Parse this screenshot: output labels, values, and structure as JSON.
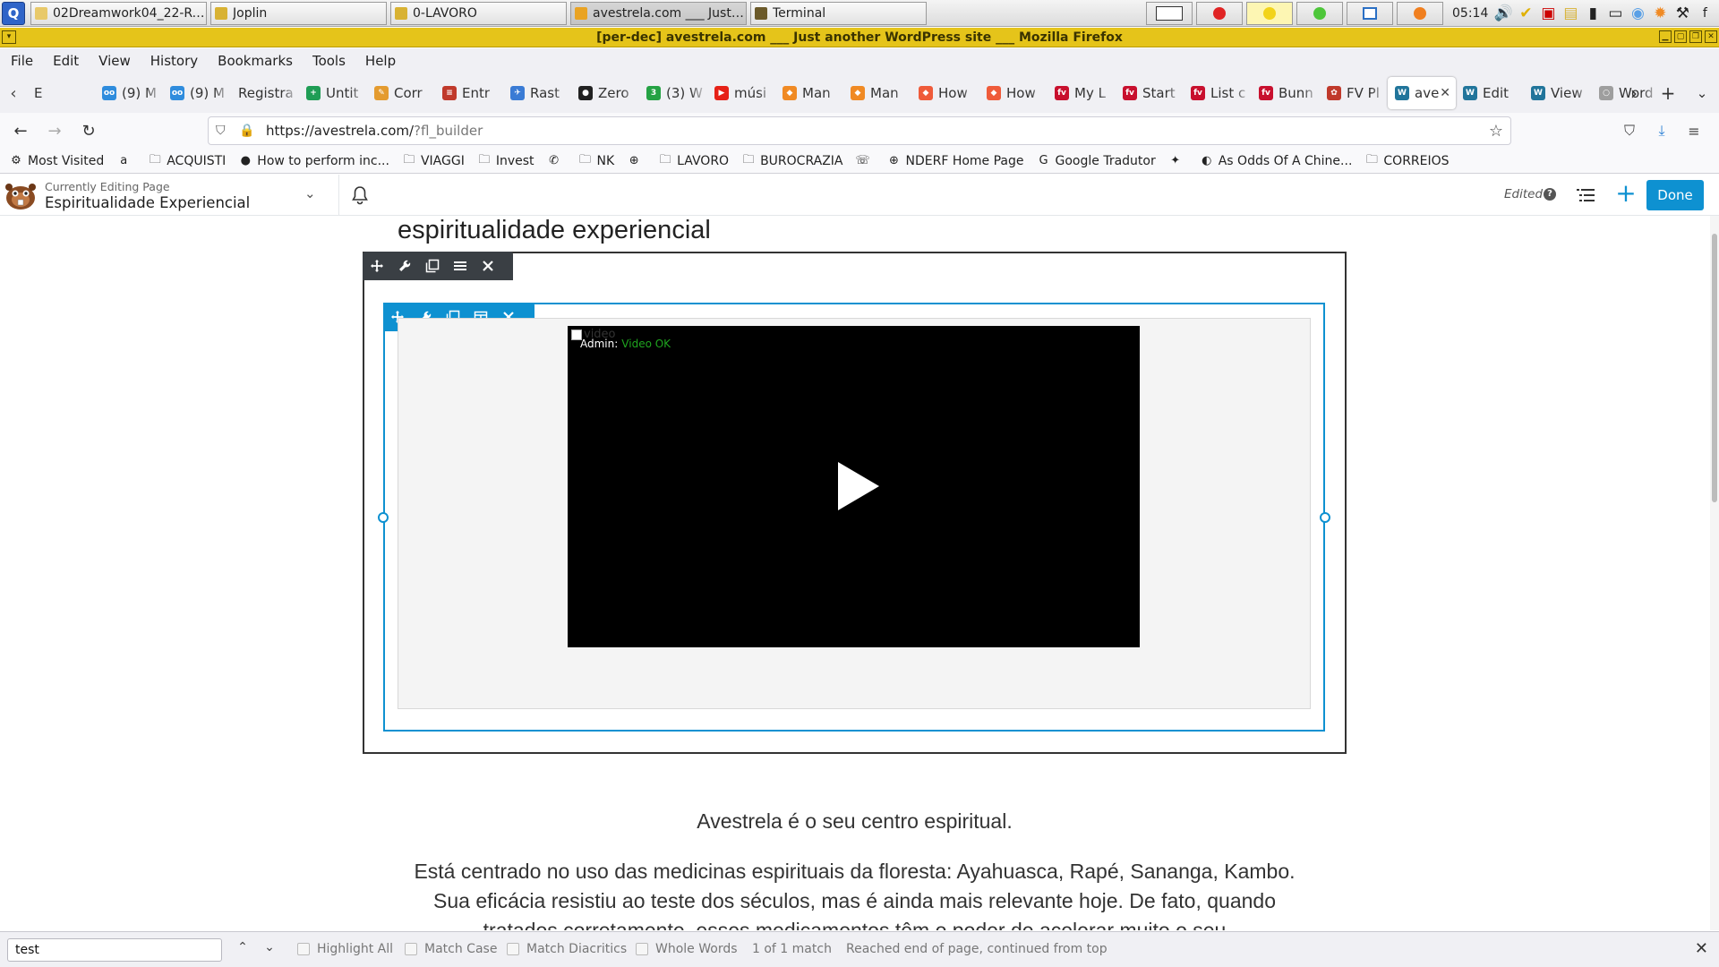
{
  "taskbar": {
    "start_label": "Q",
    "tasks": [
      {
        "label": "02Dreamwork04_22-Rob...",
        "icon": "folder-icon",
        "color": "#e8c96a"
      },
      {
        "label": "Joplin",
        "icon": "lock-icon",
        "color": "#d8b233"
      },
      {
        "label": "0-LAVORO",
        "icon": "file-icon",
        "color": "#d8b233"
      },
      {
        "label": "avestrela.com ___ Just a...",
        "icon": "firefox-icon",
        "color": "#e9a323",
        "active": true
      },
      {
        "label": "Terminal",
        "icon": "terminal-icon",
        "color": "#6b5a2a"
      }
    ],
    "clock": "05:14"
  },
  "window": {
    "title": "[per-dec] avestrela.com ___ Just another WordPress site ___ Mozilla Firefox"
  },
  "menu": [
    "File",
    "Edit",
    "View",
    "History",
    "Bookmarks",
    "Tools",
    "Help"
  ],
  "tabs": [
    {
      "label": "E",
      "color": "#ffffff"
    },
    {
      "label": "(9) M",
      "color": "#2f8cdd",
      "fav": "oo"
    },
    {
      "label": "(9) M",
      "color": "#2f8cdd",
      "fav": "oo"
    },
    {
      "label": "Registra",
      "color": "#ffffff"
    },
    {
      "label": "Untit",
      "color": "#1f9d55",
      "fav": "+"
    },
    {
      "label": "Corr",
      "color": "#e49b2f",
      "fav": "✎"
    },
    {
      "label": "Entr",
      "color": "#c0392b",
      "fav": "≡"
    },
    {
      "label": "Rast",
      "color": "#3a7bd5",
      "fav": "✈"
    },
    {
      "label": "Zero",
      "color": "#222222",
      "fav": "●"
    },
    {
      "label": "(3) W",
      "color": "#25a244",
      "fav": "3"
    },
    {
      "label": "músi",
      "color": "#e62117",
      "fav": "▶"
    },
    {
      "label": "Man",
      "color": "#f08a24",
      "fav": "◆"
    },
    {
      "label": "Man",
      "color": "#f08a24",
      "fav": "◆"
    },
    {
      "label": "How",
      "color": "#ef5b3a",
      "fav": "◆"
    },
    {
      "label": "How",
      "color": "#ef5b3a",
      "fav": "◆"
    },
    {
      "label": "My L",
      "color": "#c8102e",
      "fav": "fv"
    },
    {
      "label": "Start",
      "color": "#c8102e",
      "fav": "fv"
    },
    {
      "label": "List c",
      "color": "#c8102e",
      "fav": "fv"
    },
    {
      "label": "Bunn",
      "color": "#c8102e",
      "fav": "fv"
    },
    {
      "label": "FV Pl",
      "color": "#c0392b",
      "fav": "✿"
    },
    {
      "label": "ave",
      "color": "#21759b",
      "fav": "W",
      "selected": true
    },
    {
      "label": "Edit",
      "color": "#21759b",
      "fav": "W"
    },
    {
      "label": "View",
      "color": "#21759b",
      "fav": "W"
    },
    {
      "label": "Word",
      "color": "#9e9e9e",
      "fav": "○"
    }
  ],
  "nav": {
    "url_host": "https://avestrela.com/",
    "url_path": "?fl_builder"
  },
  "bookmarks": [
    {
      "label": "Most Visited",
      "icon": "gear-icon",
      "glyph": "⚙"
    },
    {
      "label": "",
      "icon": "amazon-icon",
      "glyph": "a"
    },
    {
      "label": "ACQUISTI",
      "icon": "folder-icon",
      "glyph": "🗀"
    },
    {
      "label": "How to perform inc...",
      "icon": "ubuntu-icon",
      "glyph": "●"
    },
    {
      "label": "VIAGGI",
      "icon": "folder-icon",
      "glyph": "🗀"
    },
    {
      "label": "Invest",
      "icon": "folder-icon",
      "glyph": "🗀"
    },
    {
      "label": "",
      "icon": "whatsapp-icon",
      "glyph": "✆"
    },
    {
      "label": "NK",
      "icon": "folder-icon",
      "glyph": "🗀"
    },
    {
      "label": "",
      "icon": "globe-icon",
      "glyph": "⊕"
    },
    {
      "label": "LAVORO",
      "icon": "folder-icon",
      "glyph": "🗀"
    },
    {
      "label": "BUROCRAZIA",
      "icon": "folder-icon",
      "glyph": "🗀"
    },
    {
      "label": "",
      "icon": "phone-icon",
      "glyph": "☏"
    },
    {
      "label": "NDERF Home Page",
      "icon": "globe-icon",
      "glyph": "⊕"
    },
    {
      "label": "Google Tradutor",
      "icon": "translate-icon",
      "glyph": "G"
    },
    {
      "label": "",
      "icon": "twitter-icon",
      "glyph": "✦"
    },
    {
      "label": "As Odds Of A Chine...",
      "icon": "page-icon",
      "glyph": "◐"
    },
    {
      "label": "CORREIOS",
      "icon": "folder-icon",
      "glyph": "🗀"
    }
  ],
  "builder": {
    "subtitle": "Currently Editing Page",
    "title": "Espiritualidade Experiencial",
    "status": "Edited",
    "done_label": "Done",
    "accent": "#0e91d1"
  },
  "page": {
    "heading": "espiritualidade experiencial",
    "video_alt": "video",
    "admin_label": "Admin:",
    "video_ok": "Video OK",
    "intro": "Avestrela é o seu centro espiritual.",
    "body": "Está centrado no uso das medicinas espirituais da floresta: Ayahuasca, Rapé, Sananga, Kambo. Sua eficácia resistiu ao teste dos séculos, mas é ainda mais relevante hoje. De fato, quando tratados corretamente, esses medicamentos têm o poder de acelerar muito o seu"
  },
  "findbar": {
    "query": "test",
    "highlight_all": "Highlight All",
    "match_case": "Match Case",
    "match_diacritics": "Match Diacritics",
    "whole_words": "Whole Words",
    "count": "1 of 1 match",
    "status": "Reached end of page, continued from top"
  }
}
